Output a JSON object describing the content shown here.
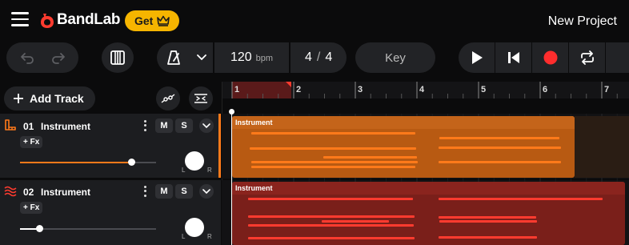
{
  "app": {
    "brand": "BandLab",
    "get_label": "Get",
    "project_title": "New Project"
  },
  "toolbar": {
    "tempo_value": "120",
    "tempo_unit": "bpm",
    "time_sig_num": "4",
    "time_sig_sep": "/",
    "time_sig_den": "4",
    "key_label": "Key"
  },
  "left_panel": {
    "add_track_label": "Add Track"
  },
  "ruler": {
    "bars": [
      "1",
      "2",
      "3",
      "4",
      "5",
      "6",
      "7"
    ]
  },
  "tracks": [
    {
      "number": "01",
      "name": "Instrument",
      "mute_label": "M",
      "solo_label": "S",
      "fx_label": "+ Fx",
      "pan_left": "L",
      "pan_right": "R",
      "volume": 0.82,
      "color": "#ff7a1a",
      "clip_label": "Instrument"
    },
    {
      "number": "02",
      "name": "Instrument",
      "mute_label": "M",
      "solo_label": "S",
      "fx_label": "+ Fx",
      "pan_left": "L",
      "pan_right": "R",
      "volume": 0.14,
      "color": "#ff3b2f",
      "clip_label": "Instrument"
    }
  ],
  "colors": {
    "accent_gold": "#f6b500",
    "track1": "#ff7a1a",
    "track2": "#ff3b2f",
    "record": "#ff2d2d",
    "brand_red": "#ff3b2f"
  },
  "icons": [
    "hamburger-icon",
    "bandlab-logo-icon",
    "crown-icon",
    "undo-icon",
    "redo-icon",
    "piano-icon",
    "metronome-icon",
    "chevron-down-icon",
    "play-icon",
    "skip-back-icon",
    "record-icon",
    "loop-icon",
    "plus-icon",
    "automation-icon",
    "tuner-icon",
    "piano-keys-track-icon",
    "waveform-track-icon",
    "kebab-icon"
  ]
}
